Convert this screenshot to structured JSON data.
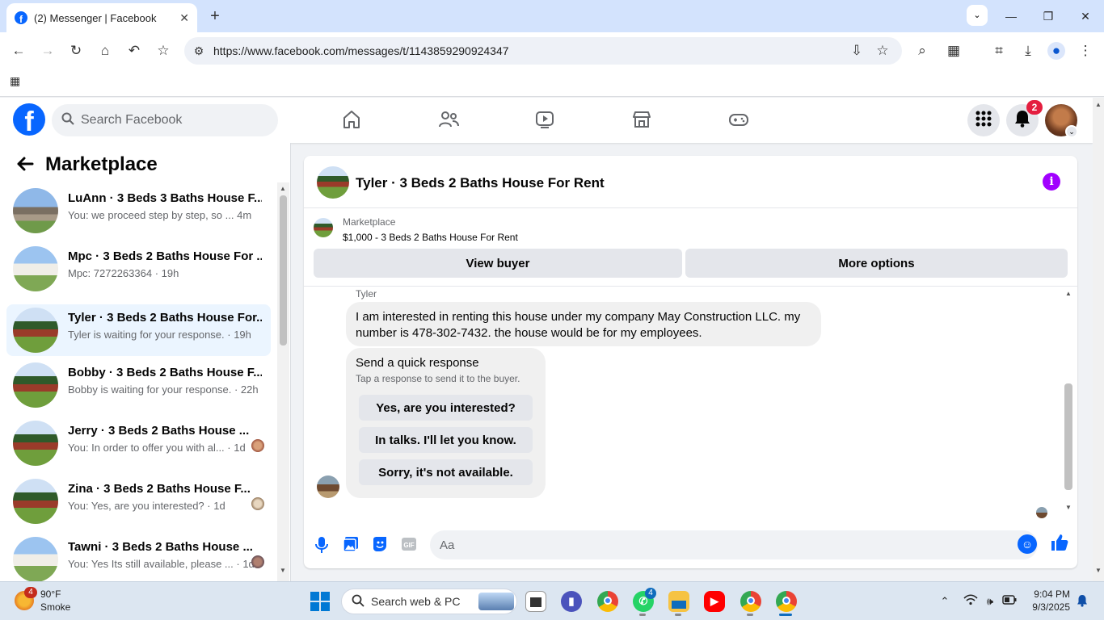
{
  "browser": {
    "tab_title": "(2) Messenger | Facebook",
    "url": "https://www.facebook.com/messages/t/1143859290924347"
  },
  "fb": {
    "logo_letter": "f",
    "search_placeholder": "Search Facebook",
    "notification_count": "2"
  },
  "sidebar": {
    "title": "Marketplace",
    "conversations": [
      {
        "name": "LuAnn · 3 Beds 3 Baths House F...",
        "snippet": "You: we proceed step by step, so ...",
        "time": "4m"
      },
      {
        "name": "Mpc · 3 Beds 2 Baths House For ...",
        "snippet": "Mpc: 7272263364",
        "time": "19h"
      },
      {
        "name": "Tyler · 3 Beds 2 Baths House For...",
        "snippet": "Tyler is waiting for your response.",
        "time": "19h"
      },
      {
        "name": "Bobby · 3 Beds 2 Baths House F...",
        "snippet": "Bobby is waiting for your response.",
        "time": "22h"
      },
      {
        "name": "Jerry · 3 Beds 2 Baths House ...",
        "snippet": "You: In order to offer you with al...",
        "time": "1d"
      },
      {
        "name": "Zina · 3 Beds 2 Baths House F...",
        "snippet": "You: Yes, are you interested?",
        "time": "1d"
      },
      {
        "name": "Tawni · 3 Beds 2 Baths House ...",
        "snippet": "You: Yes Its still available, please ...",
        "time": "1d"
      }
    ]
  },
  "chat": {
    "title": "Tyler · 3 Beds 2 Baths House For Rent",
    "listing_source": "Marketplace",
    "listing_line": "$1,000 - 3 Beds 2 Baths House For Rent",
    "view_buyer_label": "View buyer",
    "more_options_label": "More options",
    "sender_name": "Tyler",
    "message": "I am interested in renting this house under my company May Construction LLC. my number is 478-302-7432. the house would be for my employees.",
    "quick_title": "Send a quick response",
    "quick_subtitle": "Tap a response to send it to the buyer.",
    "quick_responses": [
      "Yes, are you interested?",
      "In talks. I'll let you know.",
      "Sorry, it's not available."
    ],
    "composer_placeholder": "Aa"
  },
  "taskbar": {
    "weather_badge": "4",
    "temperature": "90°F",
    "weather_desc": "Smoke",
    "search_placeholder": "Search web & PC",
    "whatsapp_badge": "4",
    "time": "9:04 PM",
    "date": "9/3/2025"
  },
  "colors": {
    "fb_blue": "#0866ff",
    "active_conversation": "#ebf5ff",
    "info_purple": "#a100ff",
    "badge_red": "#e41e3f"
  }
}
